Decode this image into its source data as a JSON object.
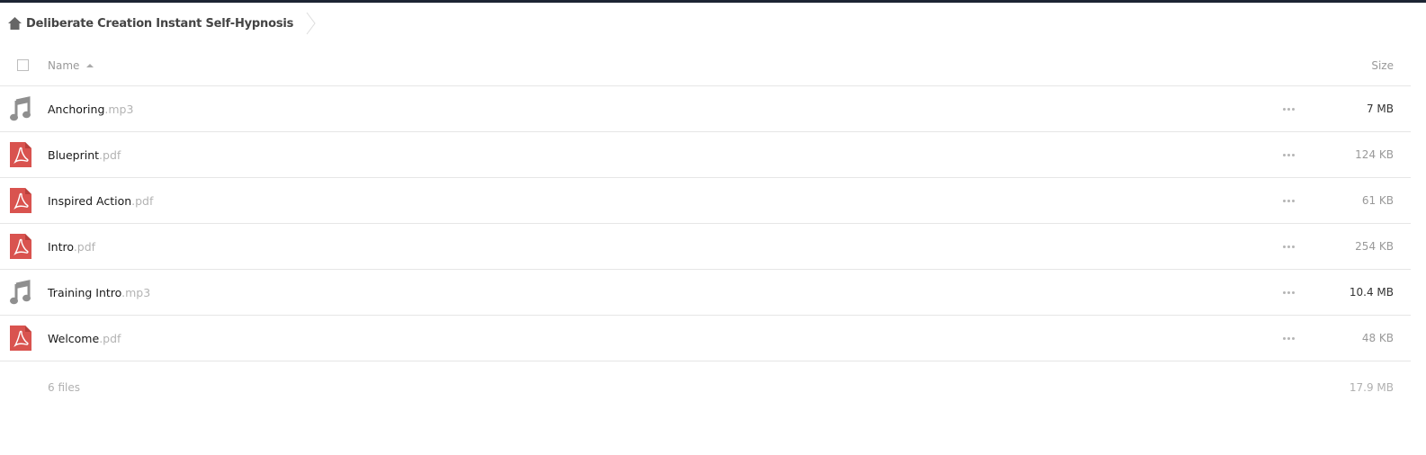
{
  "breadcrumb": {
    "home_icon": "home-icon",
    "current_folder": "Deliberate Creation Instant Self-Hypnosis"
  },
  "table": {
    "headers": {
      "name": "Name",
      "size": "Size",
      "sort": "ascending"
    },
    "files": [
      {
        "base": "Anchoring",
        "ext": ".mp3",
        "type": "audio",
        "icon": "music-note-icon",
        "size": "7 MB"
      },
      {
        "base": "Blueprint",
        "ext": ".pdf",
        "type": "pdf",
        "icon": "pdf-icon",
        "size": "124 KB"
      },
      {
        "base": "Inspired Action",
        "ext": ".pdf",
        "type": "pdf",
        "icon": "pdf-icon",
        "size": "61 KB"
      },
      {
        "base": "Intro",
        "ext": ".pdf",
        "type": "pdf",
        "icon": "pdf-icon",
        "size": "254 KB"
      },
      {
        "base": "Training Intro",
        "ext": ".mp3",
        "type": "audio",
        "icon": "music-note-icon",
        "size": "10.4 MB"
      },
      {
        "base": "Welcome",
        "ext": ".pdf",
        "type": "pdf",
        "icon": "pdf-icon",
        "size": "48 KB"
      }
    ],
    "footer": {
      "count": "6 files",
      "total": "17.9 MB"
    }
  },
  "colors": {
    "pdf": "#d9534f",
    "audio": "#8f8f8f",
    "topbar": "#1d2433"
  }
}
